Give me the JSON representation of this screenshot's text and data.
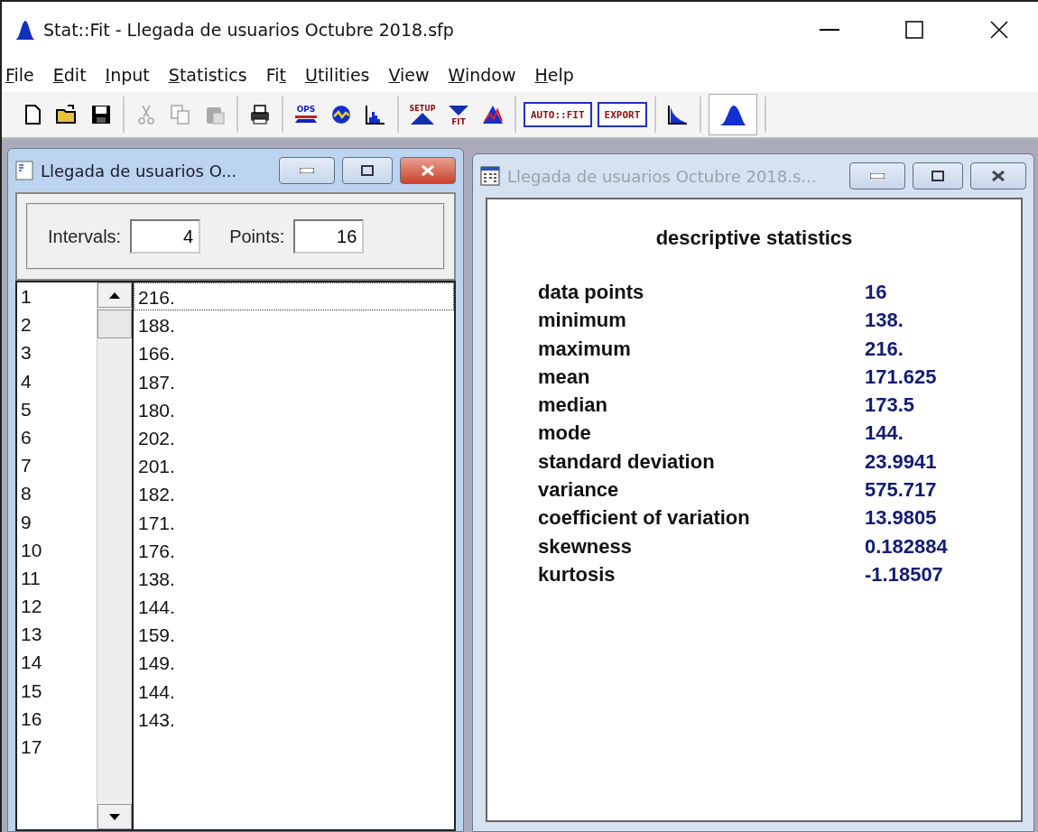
{
  "window": {
    "title": "Stat::Fit - Llegada de usuarios Octubre 2018.sfp"
  },
  "menu": [
    {
      "access_key": "F",
      "label_end": "ile"
    },
    {
      "access_key": "E",
      "label_end": "dit"
    },
    {
      "access_key": "I",
      "label_end": "nput"
    },
    {
      "access_key": "S",
      "label_end": "tatistics"
    },
    {
      "label_start": "Fi",
      "access_key": "t"
    },
    {
      "access_key": "U",
      "label_end": "tilities"
    },
    {
      "access_key": "V",
      "label_end": "iew"
    },
    {
      "access_key": "W",
      "label_end": "indow"
    },
    {
      "access_key": "H",
      "label_end": "elp"
    }
  ],
  "toolbar": [
    [
      {
        "kind": "new"
      },
      {
        "kind": "open"
      },
      {
        "kind": "save"
      }
    ],
    [
      {
        "kind": "cut",
        "disabled": true
      },
      {
        "kind": "copy",
        "disabled": true
      },
      {
        "kind": "paste",
        "disabled": true
      }
    ],
    [
      {
        "kind": "print"
      }
    ],
    [
      {
        "kind": "ops",
        "label": "OPS"
      },
      {
        "kind": "gauge"
      },
      {
        "kind": "histogram"
      }
    ],
    [
      {
        "kind": "setup",
        "label": "SETUP"
      },
      {
        "kind": "fit",
        "label": "FIT"
      },
      {
        "kind": "compare"
      }
    ],
    [
      {
        "kind": "textbutton",
        "label": "AUTO::FIT"
      },
      {
        "kind": "textbutton",
        "label": "EXPORT"
      }
    ],
    [
      {
        "kind": "distribution"
      }
    ],
    [
      {
        "kind": "peak",
        "selected": true
      }
    ]
  ],
  "data_window": {
    "title": "Llegada de usuarios O...",
    "active": true,
    "intervals_label": "Intervals:",
    "intervals": "4",
    "points_label": "Points:",
    "points": "16",
    "rows": [
      {
        "index": "1",
        "value": "216.",
        "selected": true
      },
      {
        "index": "2",
        "value": "188.",
        "selected": false
      },
      {
        "index": "3",
        "value": "166.",
        "selected": false
      },
      {
        "index": "4",
        "value": "187.",
        "selected": false
      },
      {
        "index": "5",
        "value": "180.",
        "selected": false
      },
      {
        "index": "6",
        "value": "202.",
        "selected": false
      },
      {
        "index": "7",
        "value": "201.",
        "selected": false
      },
      {
        "index": "8",
        "value": "182.",
        "selected": false
      },
      {
        "index": "9",
        "value": "171.",
        "selected": false
      },
      {
        "index": "10",
        "value": "176.",
        "selected": false
      },
      {
        "index": "11",
        "value": "138.",
        "selected": false
      },
      {
        "index": "12",
        "value": "144.",
        "selected": false
      },
      {
        "index": "13",
        "value": "159.",
        "selected": false
      },
      {
        "index": "14",
        "value": "149.",
        "selected": false
      },
      {
        "index": "15",
        "value": "144.",
        "selected": false
      },
      {
        "index": "16",
        "value": "143.",
        "selected": false
      },
      {
        "index": "17"
      }
    ]
  },
  "stats_window": {
    "title": "Llegada de usuarios Octubre 2018.s...",
    "active": false,
    "heading": "descriptive statistics",
    "stats": [
      {
        "label": "data points",
        "value": "16"
      },
      {
        "label": "minimum",
        "value": "138."
      },
      {
        "label": "maximum",
        "value": "216."
      },
      {
        "label": "mean",
        "value": "171.625"
      },
      {
        "label": "median",
        "value": "173.5"
      },
      {
        "label": "mode",
        "value": "144."
      },
      {
        "label": "standard deviation",
        "value": "23.9941"
      },
      {
        "label": "variance",
        "value": "575.717"
      },
      {
        "label": "coefficient of variation",
        "value": "13.9805"
      },
      {
        "label": "skewness",
        "value": "0.182884"
      },
      {
        "label": "kurtosis",
        "value": "-1.18507"
      }
    ]
  }
}
